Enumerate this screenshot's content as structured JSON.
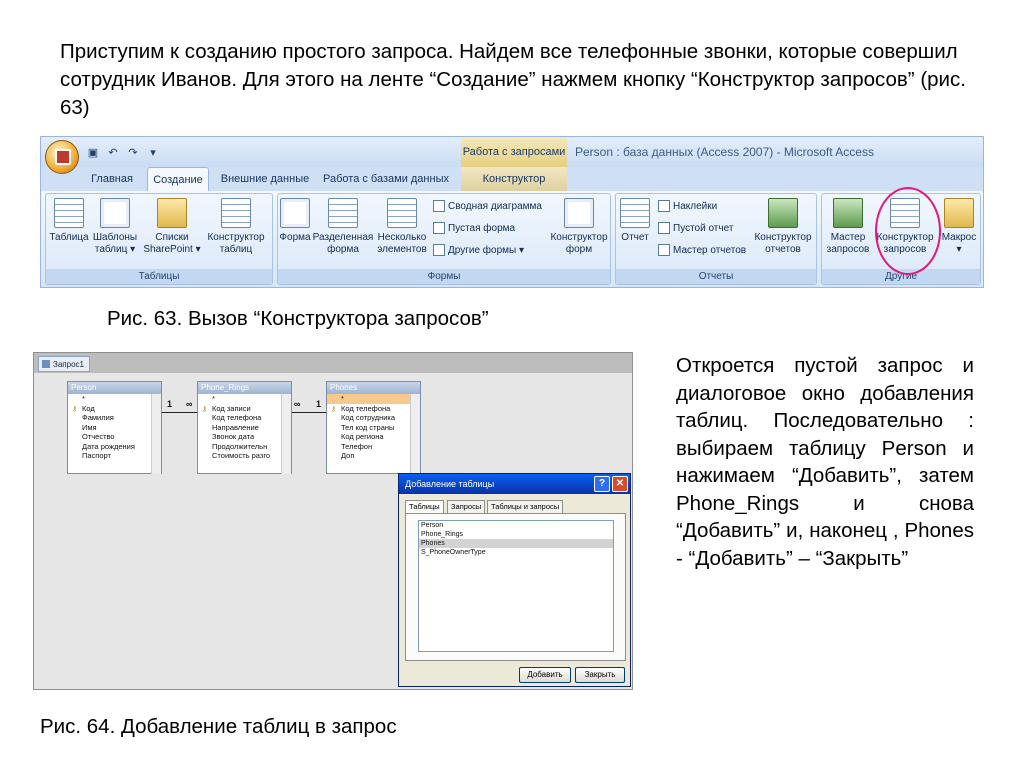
{
  "intro": "Приступим к созданию простого запроса. Найдем все телефонные звонки, которые совершил сотрудник  Иванов. Для этого на ленте “Создание” нажмем кнопку “Конструктор запросов” (рис. 63)",
  "caption63": "Рис. 63. Вызов “Конструктора запросов”",
  "side_text": "Откроется пустой запрос и диалоговое окно добавления таблиц. Последовательно : выбираем таблицу Person и нажимаем “Добавить”, затем Phone_Rings и снова “Добавить” и, наконец , Phones - “Добавить” – “Закрыть”",
  "caption64": "Рис. 64. Добавление таблиц в запрос",
  "ribbon": {
    "context_header": "Работа с запросами",
    "app_title": "Person : база данных (Access 2007) - Microsoft Access",
    "tabs": [
      "Главная",
      "Создание",
      "Внешние данные",
      "Работа с базами данных",
      "Конструктор"
    ],
    "groups": {
      "tables": {
        "label": "Таблицы",
        "buttons": [
          "Таблица",
          "Шаблоны таблиц ▾",
          "Списки SharePoint ▾",
          "Конструктор таблиц"
        ]
      },
      "forms": {
        "label": "Формы",
        "buttons": [
          "Форма",
          "Разделенная форма",
          "Несколько элементов",
          "Конструктор форм"
        ],
        "small": [
          "Сводная диаграмма",
          "Пустая форма",
          "Другие формы ▾"
        ]
      },
      "reports": {
        "label": "Отчеты",
        "buttons": [
          "Отчет",
          "Конструктор отчетов"
        ],
        "small": [
          "Наклейки",
          "Пустой отчет",
          "Мастер отчетов"
        ]
      },
      "other": {
        "label": "Другие",
        "buttons": [
          "Мастер запросов",
          "Конструктор запросов",
          "Макрос ▾"
        ]
      }
    }
  },
  "designer": {
    "tab": "Запрос1",
    "tables": [
      {
        "name": "Person",
        "fields": [
          "*",
          "Код",
          "Фамилия",
          "Имя",
          "Отчество",
          "Дата рождения",
          "Паспорт"
        ],
        "key_index": 1
      },
      {
        "name": "Phone_Rings",
        "fields": [
          "*",
          "Код записи",
          "Код телефона",
          "Направление",
          "Звонок дата",
          "Продолжительн",
          "Стоимость разго"
        ],
        "key_index": 1
      },
      {
        "name": "Phones",
        "fields": [
          "*",
          "Код телефона",
          "Код сотрудника",
          "Тел код страны",
          "Код региона",
          "Телефон",
          "Доп"
        ],
        "key_index": 1
      }
    ],
    "relations": {
      "one": "1",
      "many": "∞"
    }
  },
  "dialog": {
    "title": "Добавление таблицы",
    "help": "?",
    "close": "✕",
    "tabs": [
      "Таблицы",
      "Запросы",
      "Таблицы и запросы"
    ],
    "items": [
      "Person",
      "Phone_Rings",
      "Phones",
      "S_PhoneOwnerType"
    ],
    "selected_index": 2,
    "add_button": "Добавить",
    "close_button": "Закрыть"
  }
}
